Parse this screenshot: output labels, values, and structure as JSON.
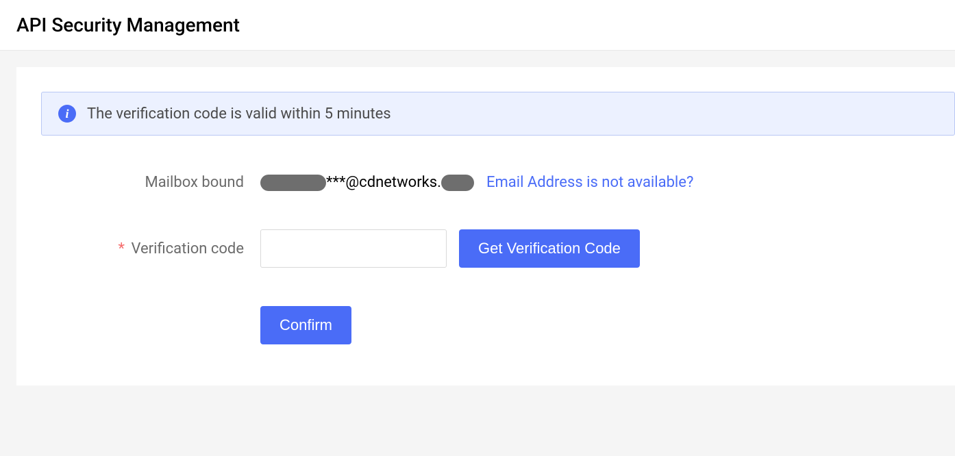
{
  "header": {
    "title": "API Security Management"
  },
  "alert": {
    "message": "The verification code is valid within 5 minutes"
  },
  "form": {
    "mailbox_label": "Mailbox bound",
    "email_masked_middle": "***@cdnetworks.",
    "email_unavailable_link": "Email Address is not available?",
    "verification_label": "Verification code",
    "get_code_button": "Get Verification Code",
    "confirm_button": "Confirm"
  }
}
